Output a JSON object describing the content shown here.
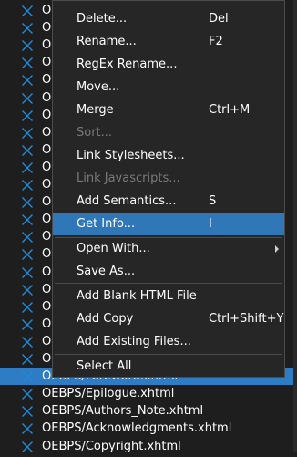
{
  "file_list": {
    "icon_color": "#1f8ad8",
    "visible_rows": [
      {
        "label": "O"
      },
      {
        "label": "O"
      },
      {
        "label": "O"
      },
      {
        "label": "O"
      },
      {
        "label": "O"
      },
      {
        "label": "O"
      },
      {
        "label": "O"
      },
      {
        "label": "O"
      },
      {
        "label": "O"
      },
      {
        "label": "O"
      },
      {
        "label": "O"
      },
      {
        "label": "O"
      },
      {
        "label": "O"
      },
      {
        "label": "O"
      },
      {
        "label": "O"
      },
      {
        "label": "O"
      },
      {
        "label": "O"
      },
      {
        "label": "O"
      },
      {
        "label": "O"
      },
      {
        "label": "O"
      },
      {
        "label": "O"
      }
    ],
    "selected_row": {
      "label": "OEBPS/Foreword.xhtml"
    },
    "bottom_rows": [
      {
        "label": "OEBPS/Epilogue.xhtml"
      },
      {
        "label": "OEBPS/Authors_Note.xhtml"
      },
      {
        "label": "OEBPS/Acknowledgments.xhtml"
      },
      {
        "label": "OEBPS/Copyright.xhtml"
      }
    ]
  },
  "context_menu": {
    "highlight_color": "#3077b7",
    "items": [
      {
        "label": "Delete...",
        "shortcut": "Del"
      },
      {
        "label": "Rename...",
        "shortcut": "F2"
      },
      {
        "label": "RegEx Rename...",
        "shortcut": ""
      },
      {
        "label": "Move...",
        "shortcut": ""
      },
      {
        "label": "Merge",
        "shortcut": "Ctrl+M"
      },
      {
        "label": "Sort...",
        "shortcut": "",
        "disabled": true
      },
      {
        "label": "Link Stylesheets...",
        "shortcut": ""
      },
      {
        "label": "Link Javascripts...",
        "shortcut": "",
        "disabled": true
      },
      {
        "label": "Add Semantics...",
        "shortcut": "S"
      },
      {
        "label": "Get Info...",
        "shortcut": "I",
        "highlighted": true
      },
      {
        "label": "Open With...",
        "shortcut": "",
        "submenu": true
      },
      {
        "label": "Save As...",
        "shortcut": ""
      },
      {
        "label": "Add Blank HTML File",
        "shortcut": ""
      },
      {
        "label": "Add Copy",
        "shortcut": "Ctrl+Shift+Y"
      },
      {
        "label": "Add Existing Files...",
        "shortcut": ""
      },
      {
        "label": "Select All",
        "shortcut": ""
      }
    ]
  }
}
